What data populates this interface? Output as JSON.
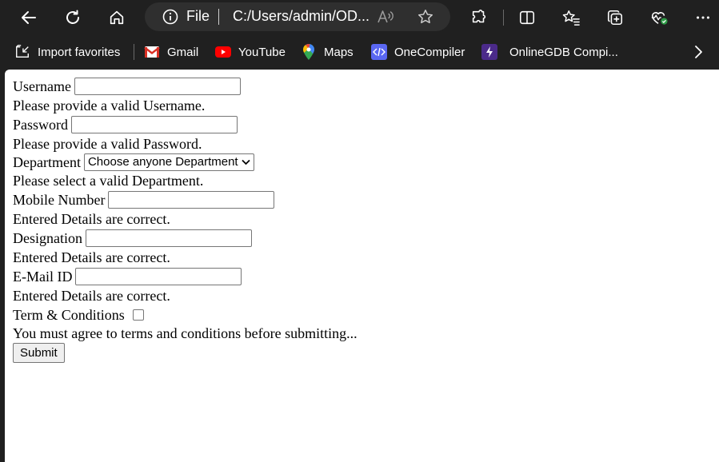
{
  "browser": {
    "address_scheme": "File",
    "address_url": "C:/Users/admin/OD...",
    "icons": [
      "back-arrow-icon",
      "refresh-icon",
      "home-icon",
      "info-icon",
      "read-aloud-icon",
      "favorite-star-icon",
      "extensions-icon",
      "split-screen-icon",
      "favorites-icon",
      "collections-icon",
      "browser-essentials-icon",
      "more-icon"
    ]
  },
  "favorites": [
    {
      "label": "Import favorites",
      "icon": "import-icon"
    },
    {
      "label": "Gmail",
      "icon": "gmail-icon"
    },
    {
      "label": "YouTube",
      "icon": "youtube-icon"
    },
    {
      "label": "Maps",
      "icon": "maps-icon"
    },
    {
      "label": "OneCompiler",
      "icon": "onecompiler-icon"
    },
    {
      "label": "OnlineGDB Compi...",
      "icon": "onlinegdb-icon"
    }
  ],
  "form": {
    "username_label": "Username",
    "username_msg": "Please provide a valid Username.",
    "password_label": "Password",
    "password_msg": "Please provide a valid Password.",
    "department_label": "Department",
    "department_selected": "Choose anyone Department",
    "department_msg": "Please select a valid Department.",
    "mobile_label": "Mobile Number",
    "mobile_msg": "Entered Details are correct.",
    "designation_label": "Designation",
    "designation_msg": "Entered Details are correct.",
    "email_label": "E-Mail ID",
    "email_msg": "Entered Details are correct.",
    "terms_label": "Term & Conditions",
    "terms_msg": "You must agree to terms and conditions before submitting...",
    "submit_label": "Submit"
  },
  "colors": {
    "chrome_bg": "#202020",
    "address_bg": "#2f2f2f",
    "page_bg": "#ffffff"
  }
}
